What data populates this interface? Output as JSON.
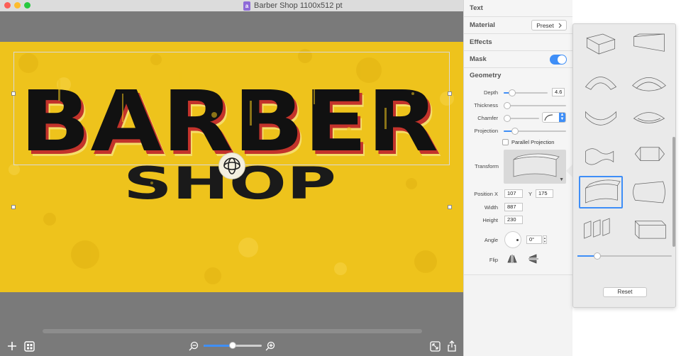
{
  "window": {
    "title": "Barber Shop 1100x512 pt",
    "doc_icon_letter": "a"
  },
  "canvas": {
    "headline": "BARBER",
    "subline": "SHOP",
    "colors": {
      "background": "#eec31c",
      "letter_face": "#111111",
      "letter_shadow": "#c3332b",
      "letter_highlight": "#f5dd6a"
    }
  },
  "bottombar": {
    "icons": [
      "plus-icon",
      "layout-icon",
      "zoom-out-icon",
      "zoom-in-icon",
      "fit-icon",
      "share-icon"
    ],
    "zoom_level": 0.5
  },
  "inspector": {
    "sections": {
      "text": "Text",
      "material": "Material",
      "preset": "Preset",
      "effects": "Effects",
      "mask": "Mask",
      "geometry": "Geometry"
    },
    "mask_enabled": true,
    "depth": {
      "label": "Depth",
      "value": "4.6",
      "slider": 0.2
    },
    "thickness": {
      "label": "Thickness",
      "slider": 0.0
    },
    "chamfer": {
      "label": "Chamfer",
      "slider": 0.0
    },
    "projection": {
      "label": "Projection",
      "slider": 0.18
    },
    "parallel_projection": {
      "label": "Parallel Projection",
      "checked": false
    },
    "transform": {
      "label": "Transform"
    },
    "position": {
      "label": "Position X",
      "x": "107",
      "y_label": "Y",
      "y": "175"
    },
    "width": {
      "label": "Width",
      "value": "887"
    },
    "height": {
      "label": "Height",
      "value": "230"
    },
    "angle": {
      "label": "Angle",
      "value": "0°"
    },
    "flip": {
      "label": "Flip"
    }
  },
  "popover": {
    "reset_label": "Reset",
    "selected_index": 8,
    "slider": 0.2,
    "shapes": [
      "bend-left",
      "wedge-right",
      "arch-up",
      "arch-ring",
      "wave-down",
      "wave-ring",
      "ripple",
      "capsule",
      "curve-panel",
      "bulge",
      "panels",
      "box"
    ]
  }
}
